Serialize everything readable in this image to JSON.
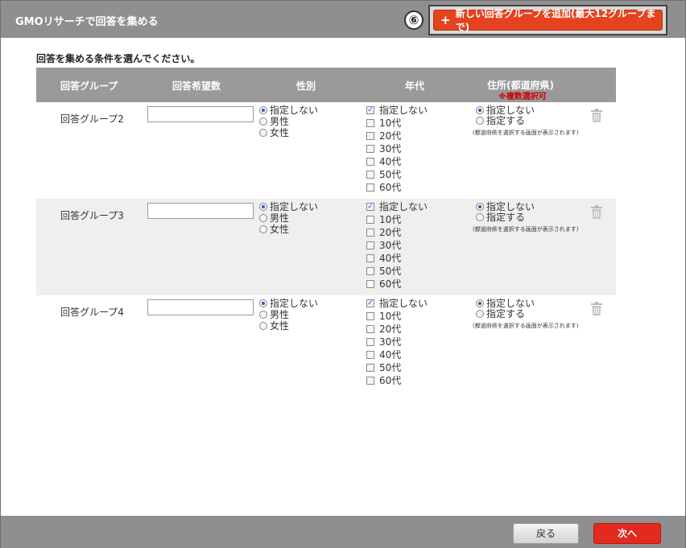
{
  "dialog": {
    "title": "GMOリサーチで回答を集める",
    "step_badge": "⑥",
    "add_group_plus": "+",
    "add_group_label": "新しい回答グループを追加(最大12グループまで)",
    "instruction": "回答を集める条件を選んでください。"
  },
  "table": {
    "headers": {
      "group": "回答グループ",
      "count": "回答希望数",
      "gender": "性別",
      "age": "年代",
      "address": "住所(都道府県)",
      "address_note": "※複数選択可"
    },
    "gender_options": [
      "指定しない",
      "男性",
      "女性"
    ],
    "age_options": [
      "指定しない",
      "10代",
      "20代",
      "30代",
      "40代",
      "50代",
      "60代"
    ],
    "address_options": [
      "指定しない",
      "指定する"
    ],
    "address_help": "(都道府県を選択する画面が表示されます)",
    "rows": [
      {
        "name": "回答グループ2",
        "count_value": "",
        "gender_selected": "指定しない",
        "age_checked": [
          "指定しない"
        ],
        "address_selected": "指定しない"
      },
      {
        "name": "回答グループ3",
        "count_value": "",
        "gender_selected": "指定しない",
        "age_checked": [
          "指定しない"
        ],
        "address_selected": "指定しない"
      },
      {
        "name": "回答グループ4",
        "count_value": "",
        "gender_selected": "指定しない",
        "age_checked": [
          "指定しない"
        ],
        "address_selected": "指定しない"
      }
    ]
  },
  "footer": {
    "back_label": "戻る",
    "next_label": "次へ"
  },
  "colors": {
    "accent": "#e5431f",
    "header_gray": "#9a9a9a",
    "note_red": "#cc0000"
  },
  "icons": {
    "trash": "trash-icon",
    "plus": "plus-icon"
  }
}
